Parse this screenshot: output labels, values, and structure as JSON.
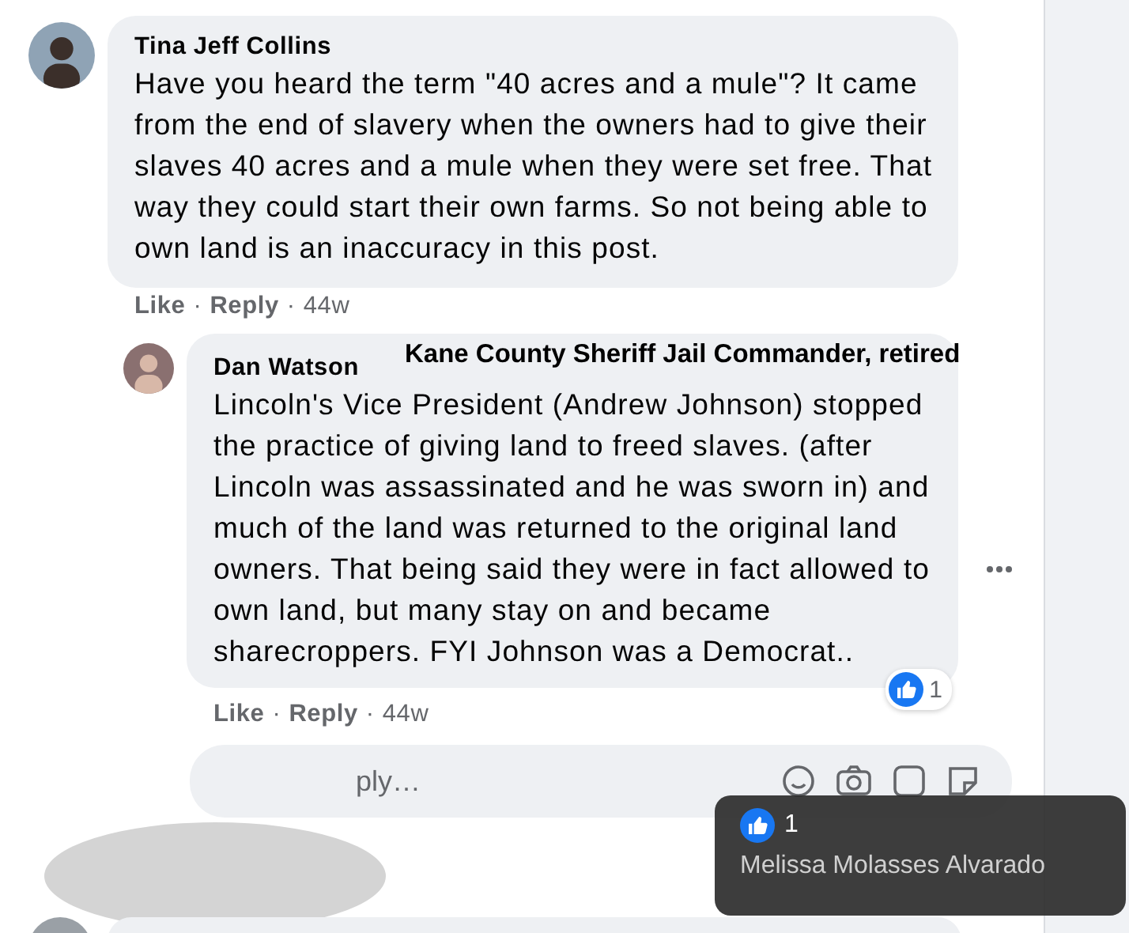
{
  "comment": {
    "author": "Tina Jeff Collins",
    "text": "Have you heard the term \"40 acres and a mule\"? It came from the end of slavery when the owners had to give their slaves 40 acres and a mule when they were set free. That way they could start their own farms. So not being able to own land is an inaccuracy in this post.",
    "actions": {
      "like": "Like",
      "separator": "·",
      "reply": "Reply",
      "time": "44w"
    }
  },
  "reply": {
    "author": "Dan Watson",
    "annotation": "Kane County Sheriff Jail Commander, retired",
    "text": "Lincoln's Vice President (Andrew Johnson) stopped the practice of giving land to freed slaves. (after Lincoln was assassinated and he was sworn in) and much of the land was returned to the original land owners. That being said they were in fact allowed to own land, but many stay on and became sharecroppers. FYI Johnson was a Democrat..",
    "reaction_count": "1",
    "actions": {
      "like": "Like",
      "separator": "·",
      "reply": "Reply",
      "time": "44w"
    }
  },
  "reply_field": {
    "placeholder": "ply…"
  },
  "reaction_tooltip": {
    "count": "1",
    "names": "Melissa Molasses Alvarado"
  }
}
